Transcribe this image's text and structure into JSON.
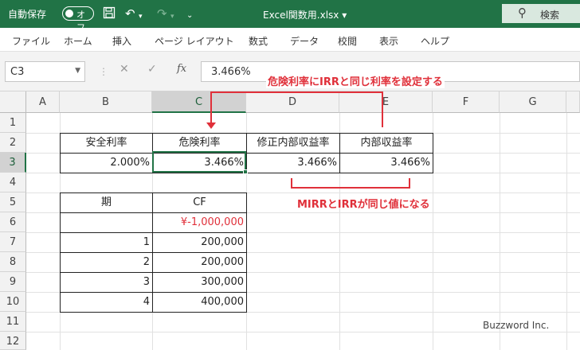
{
  "titlebar": {
    "autosave_label": "自動保存",
    "toggle_state": "オフ",
    "filename": "Excel関数用.xlsx",
    "filename_caret": "▾",
    "search_label": "検索"
  },
  "ribbon": {
    "tabs": [
      "ファイル",
      "ホーム",
      "挿入",
      "ページ レイアウト",
      "数式",
      "データ",
      "校閲",
      "表示",
      "ヘルプ"
    ]
  },
  "formula_bar": {
    "name_box": "C3",
    "formula": "3.466%"
  },
  "sheet": {
    "columns": [
      "A",
      "B",
      "C",
      "D",
      "E",
      "F",
      "G"
    ],
    "selected_column": "C",
    "rows": [
      "1",
      "2",
      "3",
      "4",
      "5",
      "6",
      "7",
      "8",
      "9",
      "10",
      "11",
      "12"
    ],
    "selected_row": "3",
    "rate_table": {
      "headers": [
        "安全利率",
        "危険利率",
        "修正内部収益率",
        "内部収益率"
      ],
      "values": [
        "2.000%",
        "3.466%",
        "3.466%",
        "3.466%"
      ]
    },
    "cf_table": {
      "headers": [
        "期",
        "CF"
      ],
      "rows": [
        {
          "period": "",
          "cf": "¥-1,000,000"
        },
        {
          "period": "1",
          "cf": "200,000"
        },
        {
          "period": "2",
          "cf": "200,000"
        },
        {
          "period": "3",
          "cf": "300,000"
        },
        {
          "period": "4",
          "cf": "400,000"
        }
      ]
    }
  },
  "annotations": {
    "top_callout": "危険利率にIRRと同じ利率を設定する",
    "bottom_callout": "MIRRとIRRが同じ値になる",
    "color": "#e0303a"
  },
  "watermark": "Buzzword Inc.",
  "colors": {
    "excel_green": "#217346",
    "negative_red": "#e0303a"
  },
  "icons": [
    "save-icon",
    "undo-icon",
    "redo-icon",
    "search-icon",
    "cancel-icon",
    "enter-icon",
    "function-icon"
  ]
}
